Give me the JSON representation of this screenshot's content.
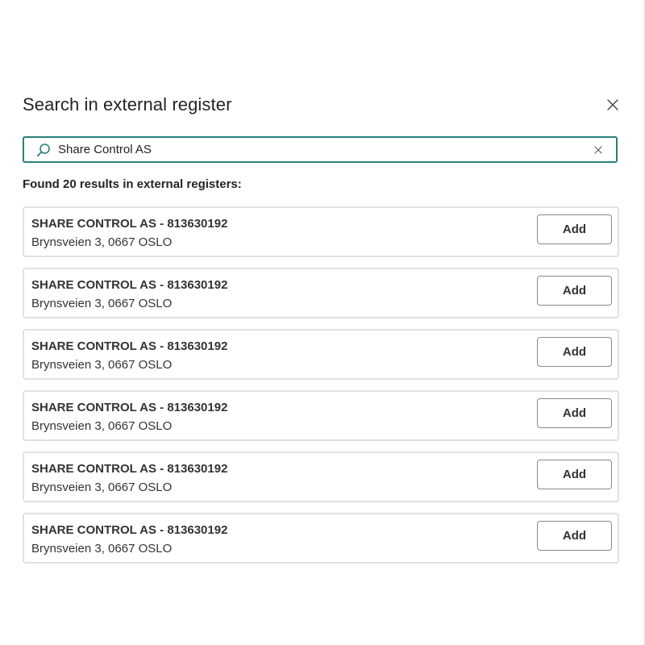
{
  "dialog": {
    "title": "Search in external register",
    "close_icon": "close-icon"
  },
  "search": {
    "value": "Share Control AS",
    "placeholder": "",
    "search_icon": "search-icon",
    "clear_icon": "clear-icon"
  },
  "results": {
    "heading": "Found 20 results in external registers:",
    "items": [
      {
        "name": "SHARE CONTROL AS - 813630192",
        "address": "Brynsveien 3, 0667 OSLO",
        "action_label": "Add"
      },
      {
        "name": "SHARE CONTROL AS - 813630192",
        "address": "Brynsveien 3, 0667 OSLO",
        "action_label": "Add"
      },
      {
        "name": "SHARE CONTROL AS - 813630192",
        "address": "Brynsveien 3, 0667 OSLO",
        "action_label": "Add"
      },
      {
        "name": "SHARE CONTROL AS - 813630192",
        "address": "Brynsveien 3, 0667 OSLO",
        "action_label": "Add"
      },
      {
        "name": "SHARE CONTROL AS - 813630192",
        "address": "Brynsveien 3, 0667 OSLO",
        "action_label": "Add"
      },
      {
        "name": "SHARE CONTROL AS - 813630192",
        "address": "Brynsveien 3, 0667 OSLO",
        "action_label": "Add"
      }
    ]
  },
  "colors": {
    "accent": "#2b7f7a",
    "card_border": "#e1e1e1",
    "button_border": "#8a8a8a",
    "text": "#242424"
  }
}
